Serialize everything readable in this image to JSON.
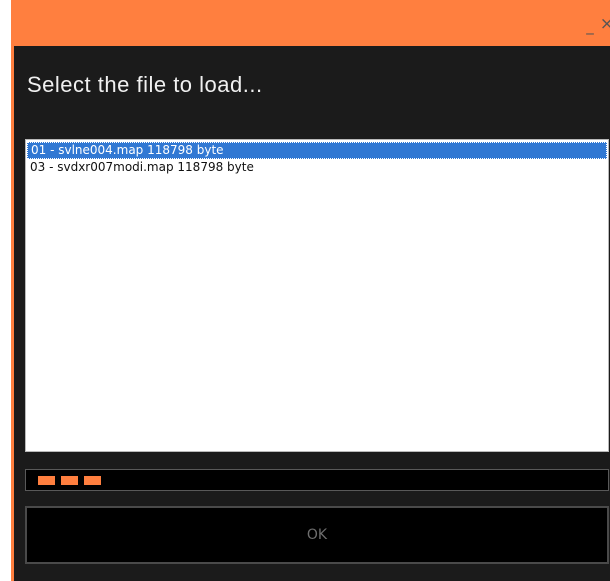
{
  "window": {
    "minimize_glyph": "_",
    "close_glyph": "×",
    "accent_color": "#ff7f3f",
    "background_color": "#1b1b1b"
  },
  "dialog": {
    "heading": "Select the file to load..."
  },
  "file_list": {
    "items": [
      {
        "label": "01 - svlne004.map 118798 byte",
        "selected": true
      },
      {
        "label": "03 - svdxr007modi.map 118798 byte",
        "selected": false
      }
    ]
  },
  "progress": {
    "segments_shown": 3
  },
  "buttons": {
    "ok_label": "OK",
    "ok_enabled": false
  }
}
